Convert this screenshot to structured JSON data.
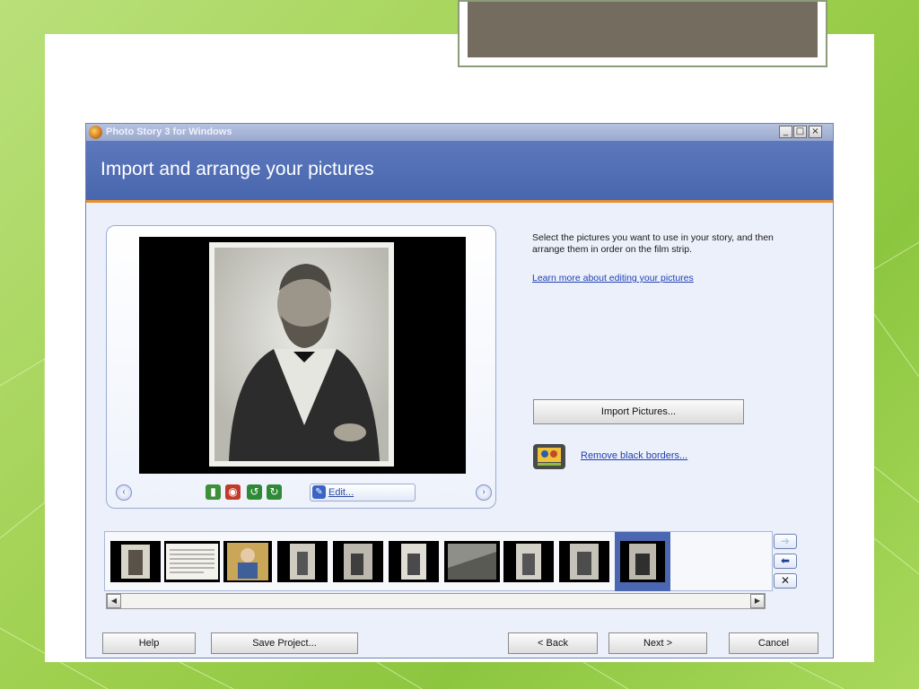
{
  "window": {
    "title": "Photo Story 3 for Windows",
    "minimize_glyph": "_",
    "maximize_glyph": "□",
    "close_glyph": "×"
  },
  "header": {
    "title": "Import and arrange your pictures"
  },
  "instructions": {
    "description": "Select the pictures you want to use in your story, and then arrange them in order on the film strip.",
    "learn_more_link": "Learn more about editing your pictures"
  },
  "viewer": {
    "prev_glyph": "‹",
    "next_glyph": "›",
    "edit_label": "Edit...",
    "tools": [
      {
        "icon": "levels-icon",
        "color": "#3d8f3a"
      },
      {
        "icon": "red-eye-icon",
        "color": "#c23b2a"
      },
      {
        "icon": "rotate-left-icon",
        "color": "#2e8a35"
      },
      {
        "icon": "rotate-right-icon",
        "color": "#2e8a35"
      }
    ]
  },
  "import_button": "Import Pictures...",
  "remove_borders_link": "Remove black borders...",
  "filmstrip": {
    "thumbnail_count": 10,
    "selected_index": 9,
    "selected_color": "#4c67b2"
  },
  "side_buttons": {
    "move_right_glyph": "➜",
    "move_left_glyph": "⬅",
    "delete_glyph": "✕"
  },
  "scrollbar": {
    "left_glyph": "◀",
    "right_glyph": "▶"
  },
  "buttons": {
    "help": "Help",
    "save_project": "Save Project...",
    "back": "< Back",
    "next": "Next >",
    "cancel": "Cancel"
  },
  "colors": {
    "header_bg": "#4f6db3",
    "accent_orange": "#e98f2c",
    "link_blue": "#1f3fb3",
    "slide_green": "#9fd04f"
  }
}
